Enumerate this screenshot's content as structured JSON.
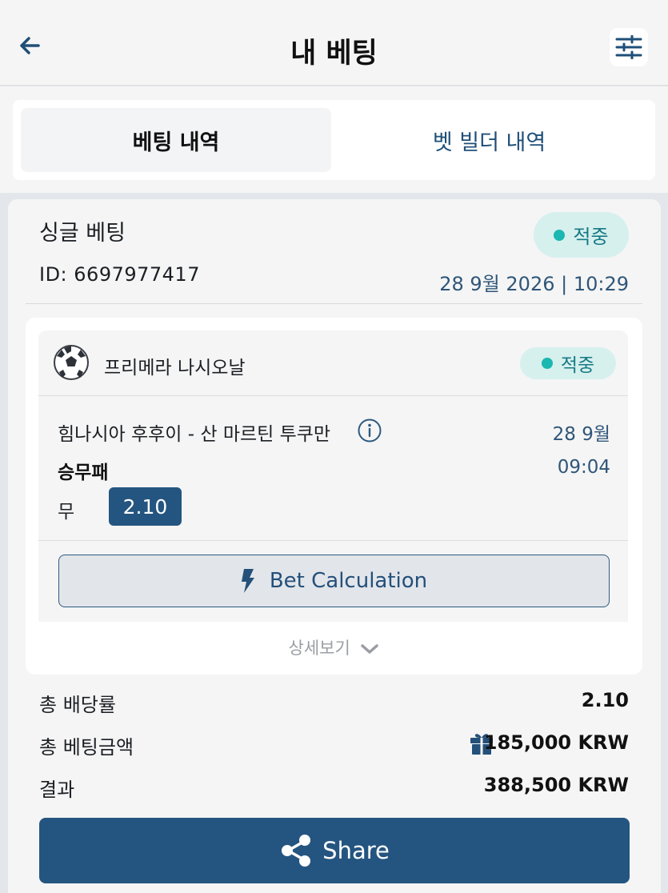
{
  "header": {
    "title": "내 베팅",
    "back_icon": "arrow-left-icon",
    "filter_icon": "sliders-icon"
  },
  "tabs": [
    {
      "label": "베팅 내역",
      "active": true
    },
    {
      "label": "벳 빌더 내역",
      "active": false
    }
  ],
  "bet": {
    "type": "싱글 베팅",
    "status": "적중",
    "id": "ID: 6697977417",
    "datetime": "28 9월 2026 | 10:29",
    "event": {
      "league_icon": "soccer-ball-icon",
      "league": "프리메라 나시오날",
      "status": "적중",
      "match": "힘나시아 후후이 - 산 마르틴 투쿠만",
      "date": "28 9월",
      "market": "승무패",
      "time": "09:04",
      "selection": "무",
      "odds": "2.10"
    },
    "calc_button": "Bet Calculation",
    "details": "상세보기"
  },
  "summary": {
    "total_odds_label": "총 배당률",
    "total_odds_value": "2.10",
    "stake_label": "총 베팅금액",
    "stake_value": "185,000 KRW",
    "result_label": "결과",
    "result_value": "388,500 KRW"
  },
  "share_label": "Share",
  "colors": {
    "primary": "#245580",
    "won_bg": "#d6f0ee",
    "won_dot": "#1bb7b1",
    "link": "#1f4f78"
  }
}
